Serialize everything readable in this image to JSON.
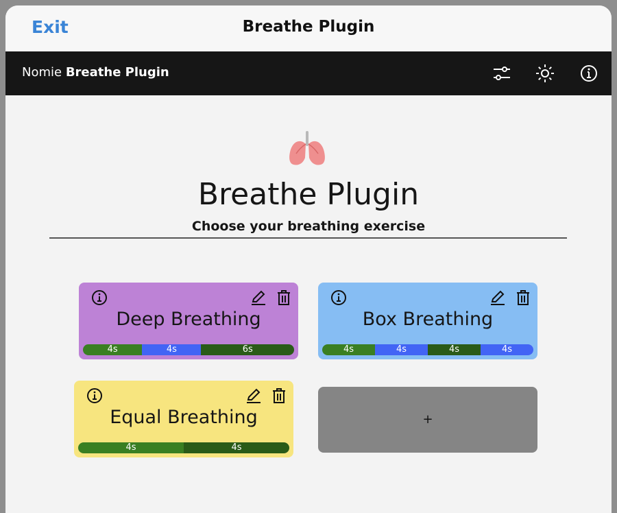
{
  "window": {
    "exit_label": "Exit",
    "title": "Breathe Plugin"
  },
  "appbar": {
    "brand_prefix": "Nomie",
    "brand_name": "Breathe Plugin",
    "icons": [
      "sliders-icon",
      "sun-icon",
      "info-icon"
    ]
  },
  "hero": {
    "icon": "lungs-icon",
    "title": "Breathe Plugin",
    "subtitle": "Choose your breathing exercise"
  },
  "exercises": [
    {
      "name": "Deep Breathing",
      "color": "#bd82d6",
      "phases": [
        {
          "label": "4s",
          "color": "#3a7f22"
        },
        {
          "label": "4s",
          "color": "#4264f5"
        },
        {
          "label": "6s",
          "color": "#2a5b18"
        }
      ]
    },
    {
      "name": "Box Breathing",
      "color": "#86bdf3",
      "phases": [
        {
          "label": "4s",
          "color": "#3a7f22"
        },
        {
          "label": "4s",
          "color": "#4264f5"
        },
        {
          "label": "4s",
          "color": "#2a5b18"
        },
        {
          "label": "4s",
          "color": "#4264f5"
        }
      ]
    },
    {
      "name": "Equal Breathing",
      "color": "#f7e57f",
      "phases": [
        {
          "label": "4s",
          "color": "#3a7f22"
        },
        {
          "label": "4s",
          "color": "#2a5b18"
        }
      ]
    }
  ],
  "add_button": {
    "label": "+"
  }
}
